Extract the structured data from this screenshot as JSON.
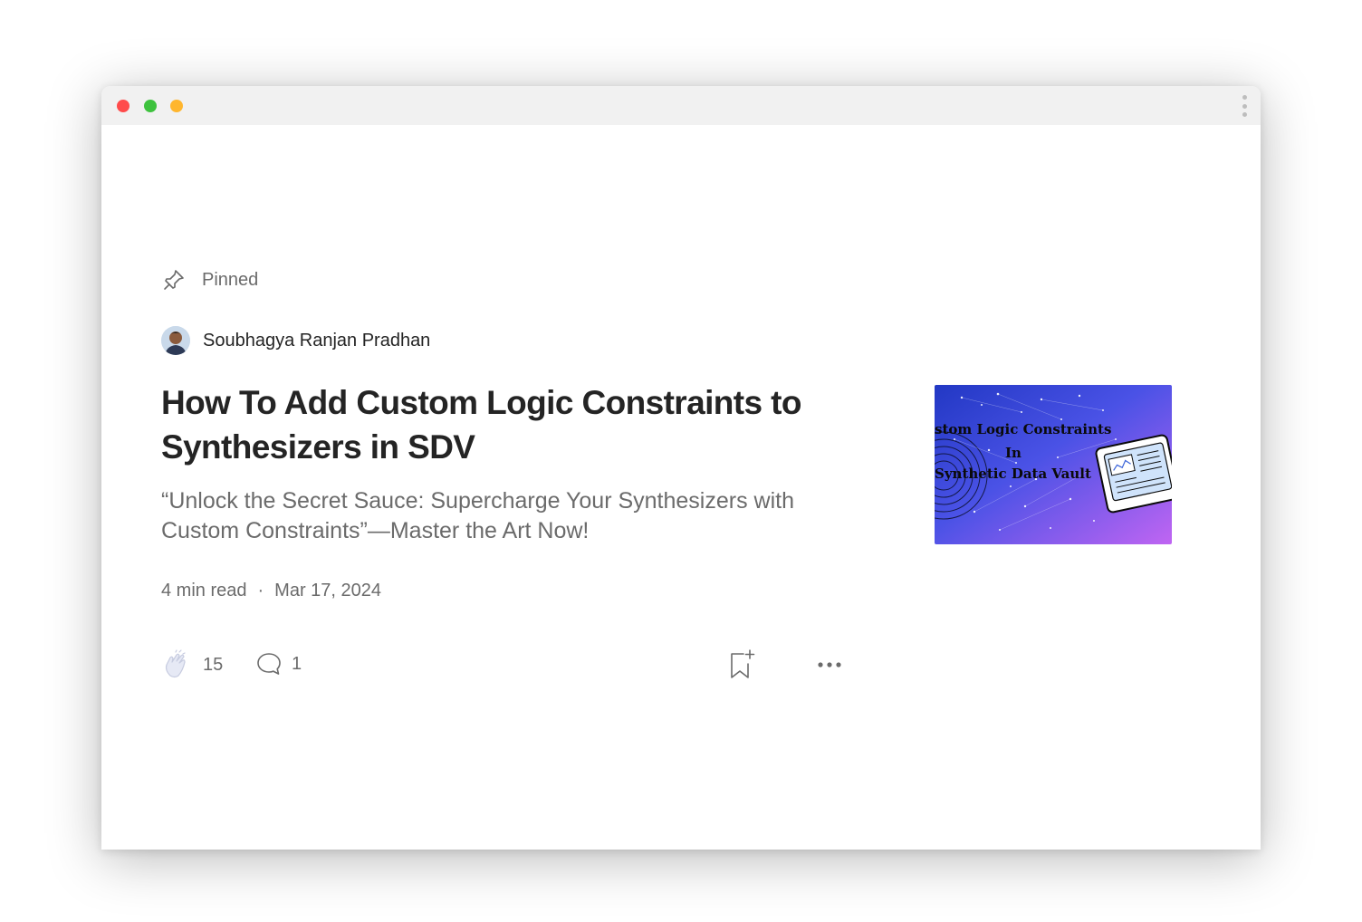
{
  "window": {
    "controls": [
      "close",
      "minimize",
      "maximize"
    ]
  },
  "post": {
    "pinned_label": "Pinned",
    "author": "Soubhagya Ranjan Pradhan",
    "title": "How To Add Custom Logic Constraints to Synthesizers in SDV",
    "subtitle": "“Unlock the Secret Sauce: Supercharge Your Synthesizers with Custom Constraints”—Master the Art Now!",
    "read_time": "4 min read",
    "separator": "·",
    "date": "Mar 17, 2024",
    "claps": "15",
    "comments": "1",
    "thumbnail_lines": [
      "stom Logic Constraints",
      "In",
      "Synthetic Data Vault"
    ]
  },
  "icons": {
    "pin": "pin-icon",
    "clap": "clap-icon",
    "comment": "comment-icon",
    "bookmark": "bookmark-add-icon",
    "more": "more-icon"
  },
  "colors": {
    "title": "#242424",
    "muted": "#6b6b6b",
    "thumb_start": "#2b3fd6",
    "thumb_end": "#b45cf0"
  }
}
